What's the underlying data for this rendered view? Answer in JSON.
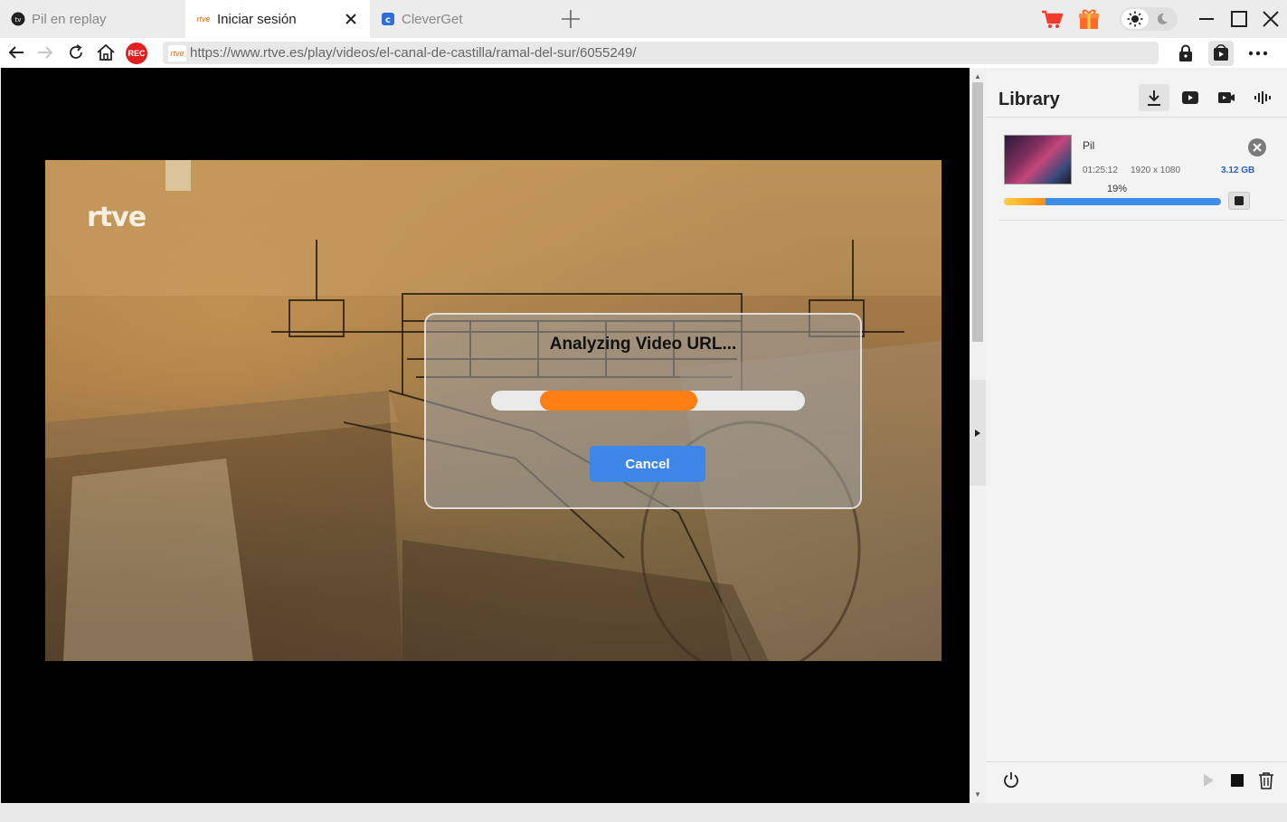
{
  "tabs": [
    {
      "label": "Pil en replay",
      "favicon": "tv-icon"
    },
    {
      "label": "Iniciar sesión",
      "favicon": "rtve-favicon",
      "favicon_text": "rtve"
    },
    {
      "label": "CleverGet",
      "favicon": "cleverget-icon"
    }
  ],
  "address_bar": {
    "url": "https://www.rtve.es/play/videos/el-canal-de-castilla/ramal-del-sur/6055249/",
    "site_icon_text": "rtve",
    "rec_label": "REC"
  },
  "video": {
    "logo_text": "rtve"
  },
  "dialog": {
    "title": "Analyzing Video URL...",
    "cancel_label": "Cancel"
  },
  "library": {
    "title": "Library",
    "tabs": [
      "download-icon",
      "youtube-icon",
      "video-icon",
      "audio-icon"
    ],
    "items": [
      {
        "name": "Pil",
        "duration": "01:25:12",
        "resolution": "1920 x 1080",
        "size": "3.12 GB",
        "progress_percent": 19,
        "progress_label": "19%"
      }
    ]
  },
  "colors": {
    "accent_blue": "#3e87e8",
    "progress_orange": "#ff7f14",
    "rec_red": "#e02020",
    "size_blue": "#2a5cc4"
  }
}
